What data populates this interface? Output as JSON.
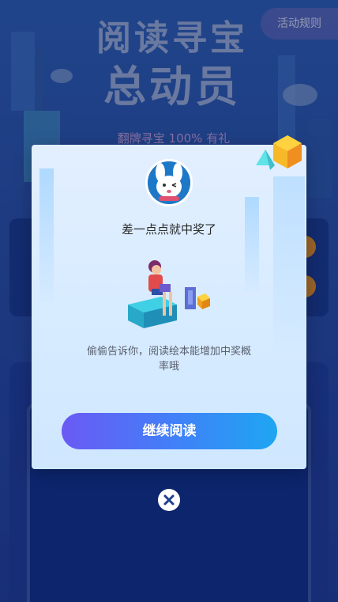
{
  "header": {
    "rules_label": "活动规则"
  },
  "hero": {
    "title_line1": "阅读寻宝",
    "title_line2": "总动员",
    "subtitle": "翻牌寻宝 100% 有礼"
  },
  "modal": {
    "title": "差一点点就中奖了",
    "description": "偷偷告诉你，阅读绘本能增加中奖概率哦",
    "continue_label": "继续阅读"
  },
  "colors": {
    "button_start": "#6a5af4",
    "button_end": "#1ea6f2",
    "modal_bg": "#d6ebff"
  }
}
